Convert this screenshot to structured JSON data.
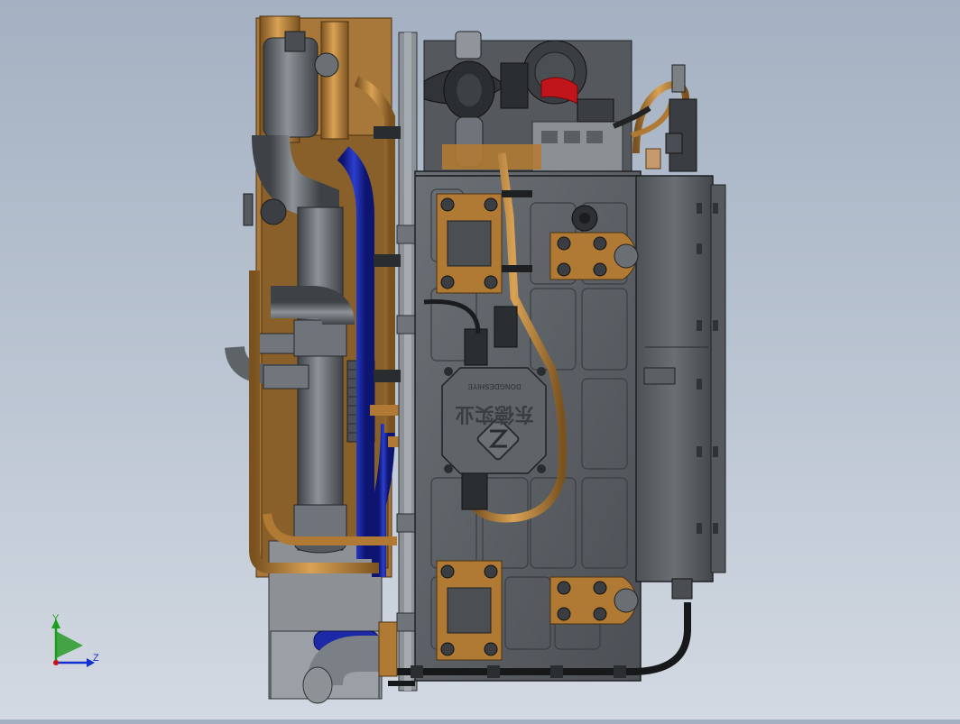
{
  "viewport": {
    "background_top": "#a4b1c2",
    "background_bottom": "#d3d9e2"
  },
  "colors": {
    "copper": "#c08a3e",
    "copper_dark": "#7a5220",
    "steel": "#5e6368",
    "steel_dark": "#34383c",
    "pipe_grey": "#6e7479",
    "blue_hose": "#1d2aa8",
    "red_part": "#c0161b",
    "axis_x": "#d01010",
    "axis_y": "#1aa01a",
    "axis_z": "#1030d0"
  },
  "model": {
    "logo_text": "东德实业",
    "logo_subtext": "DONGDESHIYE"
  },
  "triad": {
    "y_label": "Y",
    "z_label": "Z"
  }
}
